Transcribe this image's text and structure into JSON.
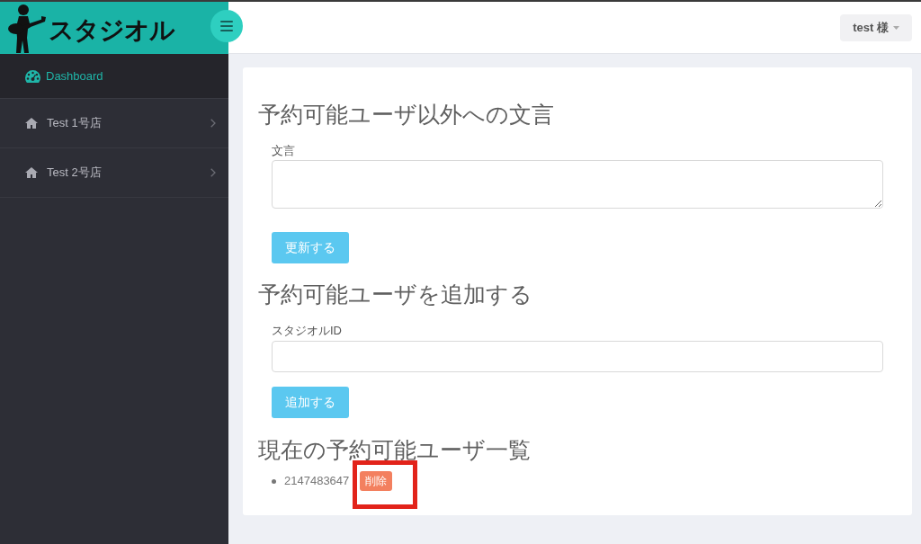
{
  "header": {
    "logo": {
      "text": "スタジオル"
    },
    "user_menu": {
      "label": "test 様"
    }
  },
  "sidebar": {
    "items": [
      {
        "kind": "page",
        "label": "Dashboard",
        "selected": true
      },
      {
        "kind": "group",
        "label": "Test 1号店",
        "selected": false
      },
      {
        "kind": "group",
        "label": "Test 2号店",
        "selected": false
      }
    ]
  },
  "sections": [
    {
      "kind": "form",
      "heading": "予約可能ユーザ以外への文言",
      "field": {
        "kind": "textarea",
        "label": "文言"
      },
      "button": {
        "label": "更新する"
      }
    },
    {
      "kind": "form",
      "heading": "予約可能ユーザを追加する",
      "field": {
        "kind": "text",
        "label": "スタジオルID"
      },
      "button": {
        "label": "追加する"
      }
    },
    {
      "kind": "list",
      "heading": "現在の予約可能ユーザ一覧",
      "items": [
        {
          "text": "2147483647",
          "action": {
            "label": "削除",
            "highlighted": true
          }
        }
      ]
    }
  ]
}
